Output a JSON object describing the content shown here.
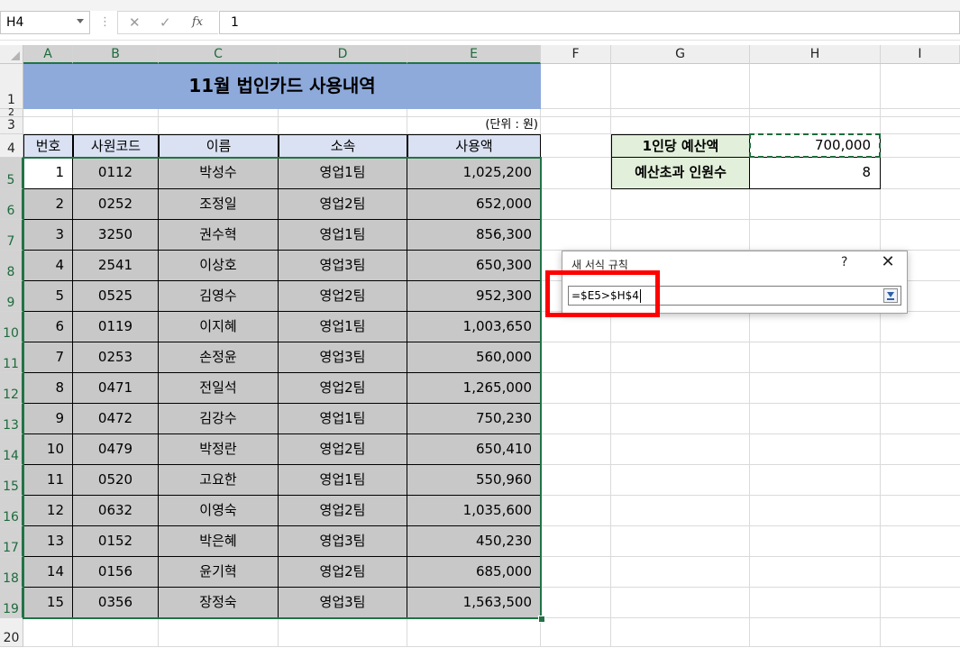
{
  "formula_bar": {
    "name_box": "H4",
    "content": "1"
  },
  "columns": [
    "A",
    "B",
    "C",
    "D",
    "E",
    "F",
    "G",
    "H",
    "I"
  ],
  "rows": [
    "1",
    "2",
    "3",
    "4",
    "5",
    "6",
    "7",
    "8",
    "9",
    "10",
    "11",
    "12",
    "13",
    "14",
    "15",
    "16",
    "17",
    "18",
    "19",
    "20"
  ],
  "sheet": {
    "title": "11월 법인카드 사용내역",
    "unit_note": "(단위 : 원)",
    "headers": [
      "번호",
      "사원코드",
      "이름",
      "소속",
      "사용액"
    ],
    "records": [
      [
        "1",
        "0112",
        "박성수",
        "영업1팀",
        "1,025,200"
      ],
      [
        "2",
        "0252",
        "조정일",
        "영업2팀",
        "652,000"
      ],
      [
        "3",
        "3250",
        "권수혁",
        "영업1팀",
        "856,300"
      ],
      [
        "4",
        "2541",
        "이상호",
        "영업3팀",
        "650,300"
      ],
      [
        "5",
        "0525",
        "김영수",
        "영업2팀",
        "952,300"
      ],
      [
        "6",
        "0119",
        "이지혜",
        "영업1팀",
        "1,003,650"
      ],
      [
        "7",
        "0253",
        "손정윤",
        "영업3팀",
        "560,000"
      ],
      [
        "8",
        "0471",
        "전일석",
        "영업2팀",
        "1,265,000"
      ],
      [
        "9",
        "0472",
        "김강수",
        "영업1팀",
        "750,230"
      ],
      [
        "10",
        "0479",
        "박정란",
        "영업2팀",
        "650,410"
      ],
      [
        "11",
        "0520",
        "고요한",
        "영업1팀",
        "550,960"
      ],
      [
        "12",
        "0632",
        "이영숙",
        "영업2팀",
        "1,035,600"
      ],
      [
        "13",
        "0152",
        "박은혜",
        "영업3팀",
        "450,230"
      ],
      [
        "14",
        "0156",
        "윤기혁",
        "영업2팀",
        "685,000"
      ],
      [
        "15",
        "0356",
        "장정숙",
        "영업3팀",
        "1,563,500"
      ]
    ],
    "budget_label": "1인당 예산액",
    "budget_value": "700,000",
    "over_label": "예산초과 인원수",
    "over_value": "8"
  },
  "dialog": {
    "title": "새 서식 규칙",
    "help": "?",
    "close": "✕",
    "formula": "=$E5>$H$4"
  },
  "colors": {
    "title_fill": "#8eaadb",
    "header_fill": "#d9e1f2",
    "data_fill": "#c8c8c8",
    "label_fill": "#e2efda",
    "selection": "#217346",
    "highlight": "#ff0000"
  }
}
